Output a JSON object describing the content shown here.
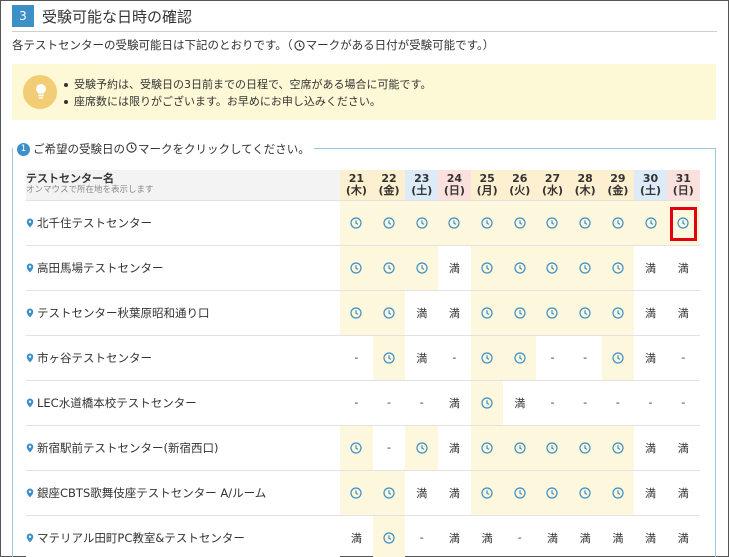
{
  "section": {
    "number": "3",
    "title": "受験可能な日時の確認"
  },
  "intro": {
    "before": "各テストセンターの受験可能日は下記のとおりです。（",
    "after": "マークがある日付が受験可能です。）"
  },
  "notice": {
    "items": [
      "受験予約は、受験日の3日前までの日程で、空席がある場合に可能です。",
      "座席数には限りがございます。お早めにお申し込みください。"
    ]
  },
  "picker": {
    "step": "1",
    "before": "ご希望の受験日の",
    "after": "マークをクリックしてください。"
  },
  "table": {
    "header_title": "テストセンター名",
    "header_sub": "オンマウスで所在地を表示します",
    "days": [
      {
        "date": "21",
        "dow": "(木)",
        "kind": "weekday"
      },
      {
        "date": "22",
        "dow": "(金)",
        "kind": "weekday"
      },
      {
        "date": "23",
        "dow": "(土)",
        "kind": "sat"
      },
      {
        "date": "24",
        "dow": "(日)",
        "kind": "sun"
      },
      {
        "date": "25",
        "dow": "(月)",
        "kind": "weekday"
      },
      {
        "date": "26",
        "dow": "(火)",
        "kind": "weekday"
      },
      {
        "date": "27",
        "dow": "(水)",
        "kind": "weekday"
      },
      {
        "date": "28",
        "dow": "(木)",
        "kind": "weekday"
      },
      {
        "date": "29",
        "dow": "(金)",
        "kind": "weekday"
      },
      {
        "date": "30",
        "dow": "(土)",
        "kind": "sat"
      },
      {
        "date": "31",
        "dow": "(日)",
        "kind": "sun"
      }
    ],
    "rows": [
      {
        "name": "北千住テストセンター",
        "cells": [
          "open",
          "open",
          "open",
          "open",
          "open",
          "open",
          "open",
          "open",
          "open",
          "open",
          "open"
        ]
      },
      {
        "name": "高田馬場テストセンター",
        "cells": [
          "open",
          "open",
          "open",
          "満",
          "open",
          "open",
          "open",
          "open",
          "open",
          "満",
          "満"
        ]
      },
      {
        "name": "テストセンター秋葉原昭和通り口",
        "cells": [
          "open",
          "open",
          "満",
          "満",
          "open",
          "open",
          "open",
          "open",
          "open",
          "満",
          "満"
        ]
      },
      {
        "name": "市ヶ谷テストセンター",
        "cells": [
          "-",
          "open",
          "満",
          "-",
          "open",
          "open",
          "-",
          "-",
          "open",
          "満",
          "-"
        ]
      },
      {
        "name": "LEC水道橋本校テストセンター",
        "cells": [
          "-",
          "-",
          "-",
          "満",
          "open",
          "満",
          "-",
          "-",
          "-",
          "-",
          "-"
        ]
      },
      {
        "name": "新宿駅前テストセンター(新宿西口)",
        "cells": [
          "open",
          "-",
          "open",
          "満",
          "open",
          "open",
          "open",
          "open",
          "open",
          "満",
          "満"
        ]
      },
      {
        "name": "銀座CBTS歌舞伎座テストセンター A/ルーム",
        "cells": [
          "open",
          "open",
          "満",
          "満",
          "open",
          "open",
          "open",
          "open",
          "open",
          "満",
          "満"
        ]
      },
      {
        "name": "マテリアル田町PC教室&テストセンター",
        "cells": [
          "満",
          "open",
          "-",
          "満",
          "満",
          "-",
          "満",
          "満",
          "満",
          "満",
          "満"
        ]
      }
    ]
  },
  "colors": {
    "accent": "#3d8fc7",
    "open_bg": "#fdf7de",
    "weekday_head": "#fdf0d0",
    "sat_head": "#dcebf7",
    "sun_head": "#fbe1dd",
    "selected_outline": "#e3000f"
  },
  "icons": {
    "clock": "clock-icon",
    "pin": "location-pin-icon",
    "notice": "bulb-icon"
  }
}
